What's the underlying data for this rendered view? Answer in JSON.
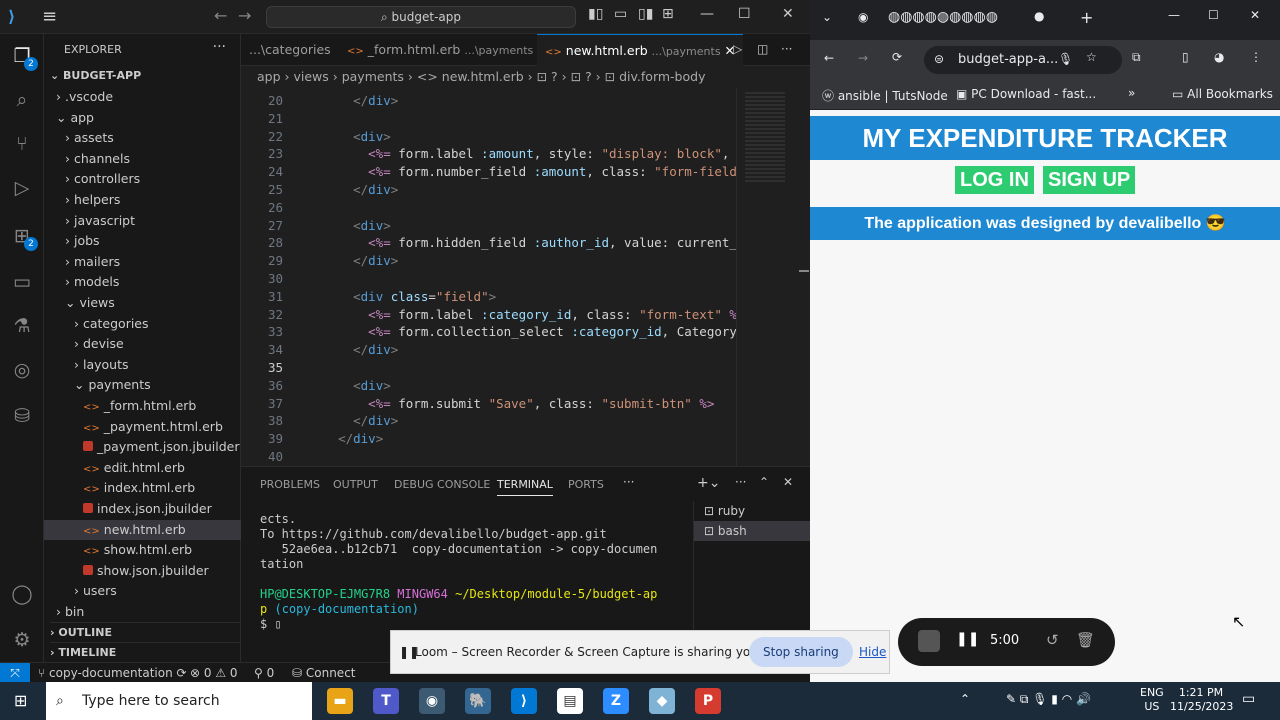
{
  "vscode": {
    "search": "budget-app",
    "explorer_title": "EXPLORER",
    "project": "BUDGET-APP",
    "tree": [
      {
        "label": ".vscode",
        "depth": 1,
        "kind": "folder-closed"
      },
      {
        "label": "app",
        "depth": 1,
        "kind": "folder-open"
      },
      {
        "label": "assets",
        "depth": 2,
        "kind": "folder-closed"
      },
      {
        "label": "channels",
        "depth": 2,
        "kind": "folder-closed"
      },
      {
        "label": "controllers",
        "depth": 2,
        "kind": "folder-closed"
      },
      {
        "label": "helpers",
        "depth": 2,
        "kind": "folder-closed"
      },
      {
        "label": "javascript",
        "depth": 2,
        "kind": "folder-closed"
      },
      {
        "label": "jobs",
        "depth": 2,
        "kind": "folder-closed"
      },
      {
        "label": "mailers",
        "depth": 2,
        "kind": "folder-closed"
      },
      {
        "label": "models",
        "depth": 2,
        "kind": "folder-closed"
      },
      {
        "label": "views",
        "depth": 2,
        "kind": "folder-open"
      },
      {
        "label": "categories",
        "depth": 3,
        "kind": "folder-closed"
      },
      {
        "label": "devise",
        "depth": 3,
        "kind": "folder-closed"
      },
      {
        "label": "layouts",
        "depth": 3,
        "kind": "folder-closed"
      },
      {
        "label": "payments",
        "depth": 3,
        "kind": "folder-open"
      },
      {
        "label": "_form.html.erb",
        "depth": 4,
        "kind": "html"
      },
      {
        "label": "_payment.html.erb",
        "depth": 4,
        "kind": "html"
      },
      {
        "label": "_payment.json.jbuilder",
        "depth": 4,
        "kind": "ruby"
      },
      {
        "label": "edit.html.erb",
        "depth": 4,
        "kind": "html"
      },
      {
        "label": "index.html.erb",
        "depth": 4,
        "kind": "html"
      },
      {
        "label": "index.json.jbuilder",
        "depth": 4,
        "kind": "ruby"
      },
      {
        "label": "new.html.erb",
        "depth": 4,
        "kind": "html",
        "selected": true
      },
      {
        "label": "show.html.erb",
        "depth": 4,
        "kind": "html"
      },
      {
        "label": "show.json.jbuilder",
        "depth": 4,
        "kind": "ruby"
      },
      {
        "label": "users",
        "depth": 3,
        "kind": "folder-closed"
      },
      {
        "label": "bin",
        "depth": 1,
        "kind": "folder-closed"
      }
    ],
    "outline": "OUTLINE",
    "timeline": "TIMELINE",
    "tabs": [
      {
        "label": "...\\categories",
        "desc": ""
      },
      {
        "label": "_form.html.erb",
        "desc": "...\\payments"
      },
      {
        "label": "new.html.erb",
        "desc": "...\\payments",
        "active": true
      }
    ],
    "breadcrumb": "app › views › payments › <> new.html.erb › ⊡ ? › ⊡ ? › ⊡ div.form-body",
    "lines": [
      {
        "n": "20",
        "html": "    <span class='tg'>&lt;/</span><span class='tn'>div</span><span class='tg'>&gt;</span>"
      },
      {
        "n": "21",
        "html": ""
      },
      {
        "n": "22",
        "html": "    <span class='tg'>&lt;</span><span class='tn'>div</span><span class='tg'>&gt;</span>"
      },
      {
        "n": "23",
        "html": "      <span class='er'>&lt;%=</span> form.label <span class='sy'>:amount</span>, style: <span class='st'>\"display: block\"</span>, c"
      },
      {
        "n": "24",
        "html": "      <span class='er'>&lt;%=</span> form.number_field <span class='sy'>:amount</span>, class: <span class='st'>\"form-field\"</span>"
      },
      {
        "n": "25",
        "html": "    <span class='tg'>&lt;/</span><span class='tn'>div</span><span class='tg'>&gt;</span>"
      },
      {
        "n": "26",
        "html": ""
      },
      {
        "n": "27",
        "html": "    <span class='tg'>&lt;</span><span class='tn'>div</span><span class='tg'>&gt;</span>"
      },
      {
        "n": "28",
        "html": "      <span class='er'>&lt;%=</span> form.hidden_field <span class='sy'>:author_id</span>, value: current_u"
      },
      {
        "n": "29",
        "html": "    <span class='tg'>&lt;/</span><span class='tn'>div</span><span class='tg'>&gt;</span>"
      },
      {
        "n": "30",
        "html": ""
      },
      {
        "n": "31",
        "html": "    <span class='tg'>&lt;</span><span class='tn'>div</span> <span class='at'>class</span>=<span class='st'>\"field\"</span><span class='tg'>&gt;</span>"
      },
      {
        "n": "32",
        "html": "      <span class='er'>&lt;%=</span> form.label <span class='sy'>:category_id</span>, class: <span class='st'>\"form-text\"</span> <span class='er'>%&gt;</span>"
      },
      {
        "n": "33",
        "html": "      <span class='er'>&lt;%=</span> form.collection_select <span class='sy'>:category_id</span>, Category."
      },
      {
        "n": "34",
        "html": "    <span class='tg'>&lt;/</span><span class='tn'>div</span><span class='tg'>&gt;</span>"
      },
      {
        "n": "35",
        "html": "",
        "cur": true
      },
      {
        "n": "36",
        "html": "    <span class='tg'>&lt;</span><span class='tn'>div</span><span class='tg'>&gt;</span>"
      },
      {
        "n": "37",
        "html": "      <span class='er'>&lt;%=</span> form.submit <span class='st'>\"Save\"</span>, class: <span class='st'>\"submit-btn\"</span> <span class='er'>%&gt;</span>"
      },
      {
        "n": "38",
        "html": "    <span class='tg'>&lt;/</span><span class='tn'>div</span><span class='tg'>&gt;</span>"
      },
      {
        "n": "39",
        "html": "  <span class='tg'>&lt;/</span><span class='tn'>div</span><span class='tg'>&gt;</span>"
      },
      {
        "n": "40",
        "html": ""
      }
    ],
    "panel_tabs": [
      "PROBLEMS",
      "OUTPUT",
      "DEBUG CONSOLE",
      "TERMINAL",
      "PORTS"
    ],
    "terminal_html": "ects.\nTo https://github.com/devalibello/budget-app.git\n   52ae6ea..b12cb71  copy-documentation -> copy-documen\ntation\n\n<span class='g'>HP@DESKTOP-EJMG7R8</span> <span class='p'>MINGW64</span> <span class='y'>~/Desktop/module-5/budget-ap\np</span> <span class='c'>(copy-documentation)</span>\n$ ▯",
    "shells": [
      "ruby",
      "bash"
    ],
    "status": {
      "branch": "copy-documentation",
      "errors": "0",
      "warnings": "0",
      "ports": "0",
      "connect": "Connect"
    }
  },
  "chrome": {
    "address": "budget-app-a...",
    "bookmarks": [
      "ansible | TutsNode",
      "PC Download - fast...",
      "All Bookmarks"
    ],
    "page": {
      "title": "MY EXPENDITURE TRACKER",
      "login": "LOG IN",
      "signup": "SIGN UP",
      "footer": "The application was designed by devalibello 😎"
    }
  },
  "loom": {
    "message": "Loom – Screen Recorder & Screen Capture is sharing your screen.",
    "stop": "Stop sharing",
    "hide": "Hide",
    "timer": "5:00"
  },
  "taskbar": {
    "search": "Type here to search",
    "time": "1:21 PM",
    "date": "11/25/2023",
    "lang1": "ENG",
    "lang2": "US"
  },
  "colors": {
    "accent": "#1e88d3",
    "green": "#2ecc71",
    "vscode_blue": "#0078d4"
  }
}
